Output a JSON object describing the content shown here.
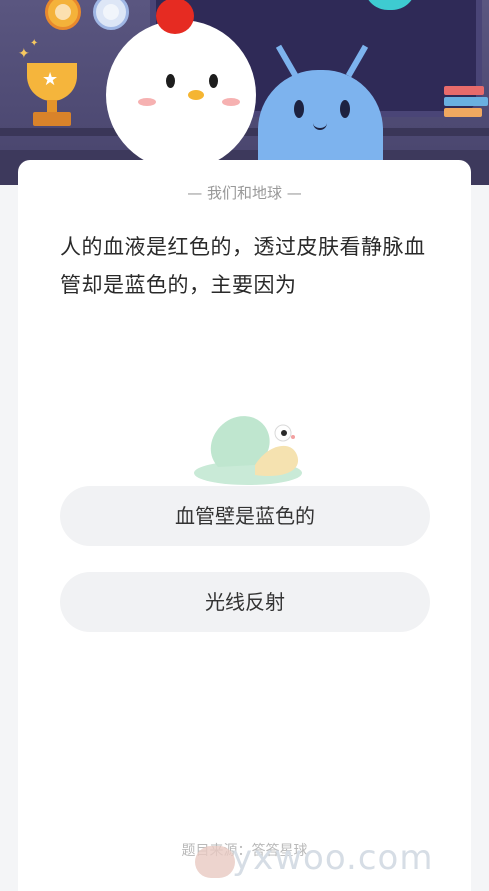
{
  "card": {
    "title": "— 我们和地球 —",
    "question": "人的血液是红色的，透过皮肤看静脉血管却是蓝色的，主要因为",
    "options": [
      {
        "label": "血管壁是蓝色的"
      },
      {
        "label": "光线反射"
      }
    ],
    "footer": "题目来源：答答星球"
  },
  "watermark": {
    "text": "yxwoo.com"
  },
  "colors": {
    "header_bg": "#4e4a6e",
    "card_bg": "#ffffff",
    "option_bg": "#f1f2f4",
    "chicken_comb": "#e62b22",
    "alien": "#7db3ee",
    "trophy": "#f5b53c"
  },
  "icons": [
    "medal-icon",
    "trophy-icon",
    "chicken-mascot",
    "alien-mascot",
    "snail-icon",
    "globe-icon",
    "books-icon"
  ]
}
